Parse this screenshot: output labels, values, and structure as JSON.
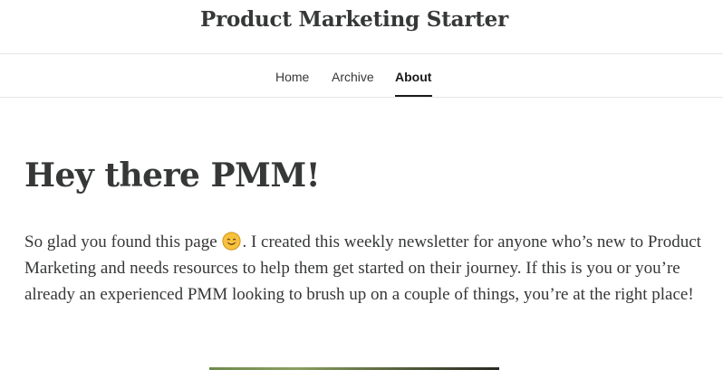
{
  "header": {
    "site_title": "Product Marketing Starter"
  },
  "nav": {
    "items": [
      {
        "label": "Home"
      },
      {
        "label": "Archive"
      },
      {
        "label": "About",
        "active": true
      }
    ]
  },
  "main": {
    "title": "Hey there PMM!",
    "intro_before_emoji": "So glad you found this page ",
    "emoji": "smiling-face-icon",
    "intro_after_emoji": ". I created this weekly newsletter for anyone who’s new to Product Marketing and needs resources to help them get started on their journey. If this is you or you’re already an experienced PMM looking to brush up on a couple of things, you’re at the right place!"
  },
  "colors": {
    "text": "#363737",
    "active_nav": "#1a1a1a",
    "divider": "#e6e6e6",
    "emoji_face": "#f7c23b"
  }
}
